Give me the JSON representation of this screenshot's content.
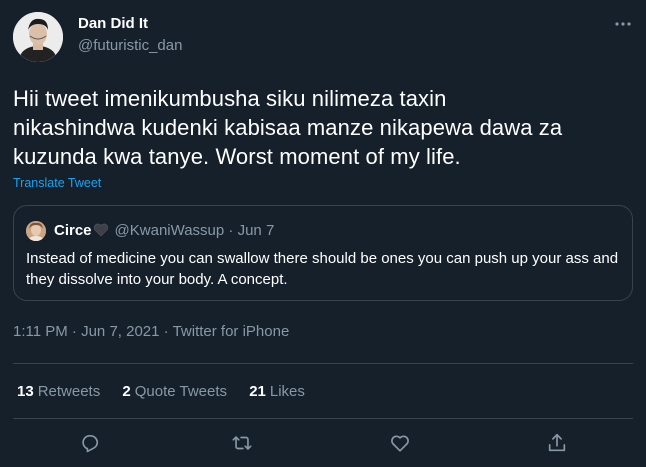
{
  "author": {
    "name": "Dan Did It",
    "handle": "@futuristic_dan"
  },
  "tweet": {
    "lines": [
      "Hii tweet imenikumbusha siku nilimeza taxin",
      "nikashindwa kudenki kabisaa manze nikapewa dawa za",
      "kuzunda kwa tanye. Worst moment of my life."
    ],
    "translate_label": "Translate Tweet"
  },
  "quote": {
    "name": "Circe",
    "name_emoji": "black-heart",
    "handle": "@KwaniWassup",
    "separator": "·",
    "date": "Jun 7",
    "text": "Instead of medicine you can swallow there should be ones you can push up your ass and they dissolve into your body. A concept."
  },
  "meta": {
    "time": "1:11 PM",
    "date": "Jun 7, 2021",
    "source": "Twitter for iPhone",
    "separator": "·"
  },
  "stats": [
    {
      "count": "13",
      "label": "Retweets"
    },
    {
      "count": "2",
      "label": "Quote Tweets"
    },
    {
      "count": "21",
      "label": "Likes"
    }
  ],
  "actions": [
    "reply-icon",
    "retweet-icon",
    "like-icon",
    "share-icon"
  ],
  "colors": {
    "background": "#15202b",
    "text": "#ffffff",
    "muted": "#8899a6",
    "border": "#38444d",
    "link": "#1da1f2"
  }
}
